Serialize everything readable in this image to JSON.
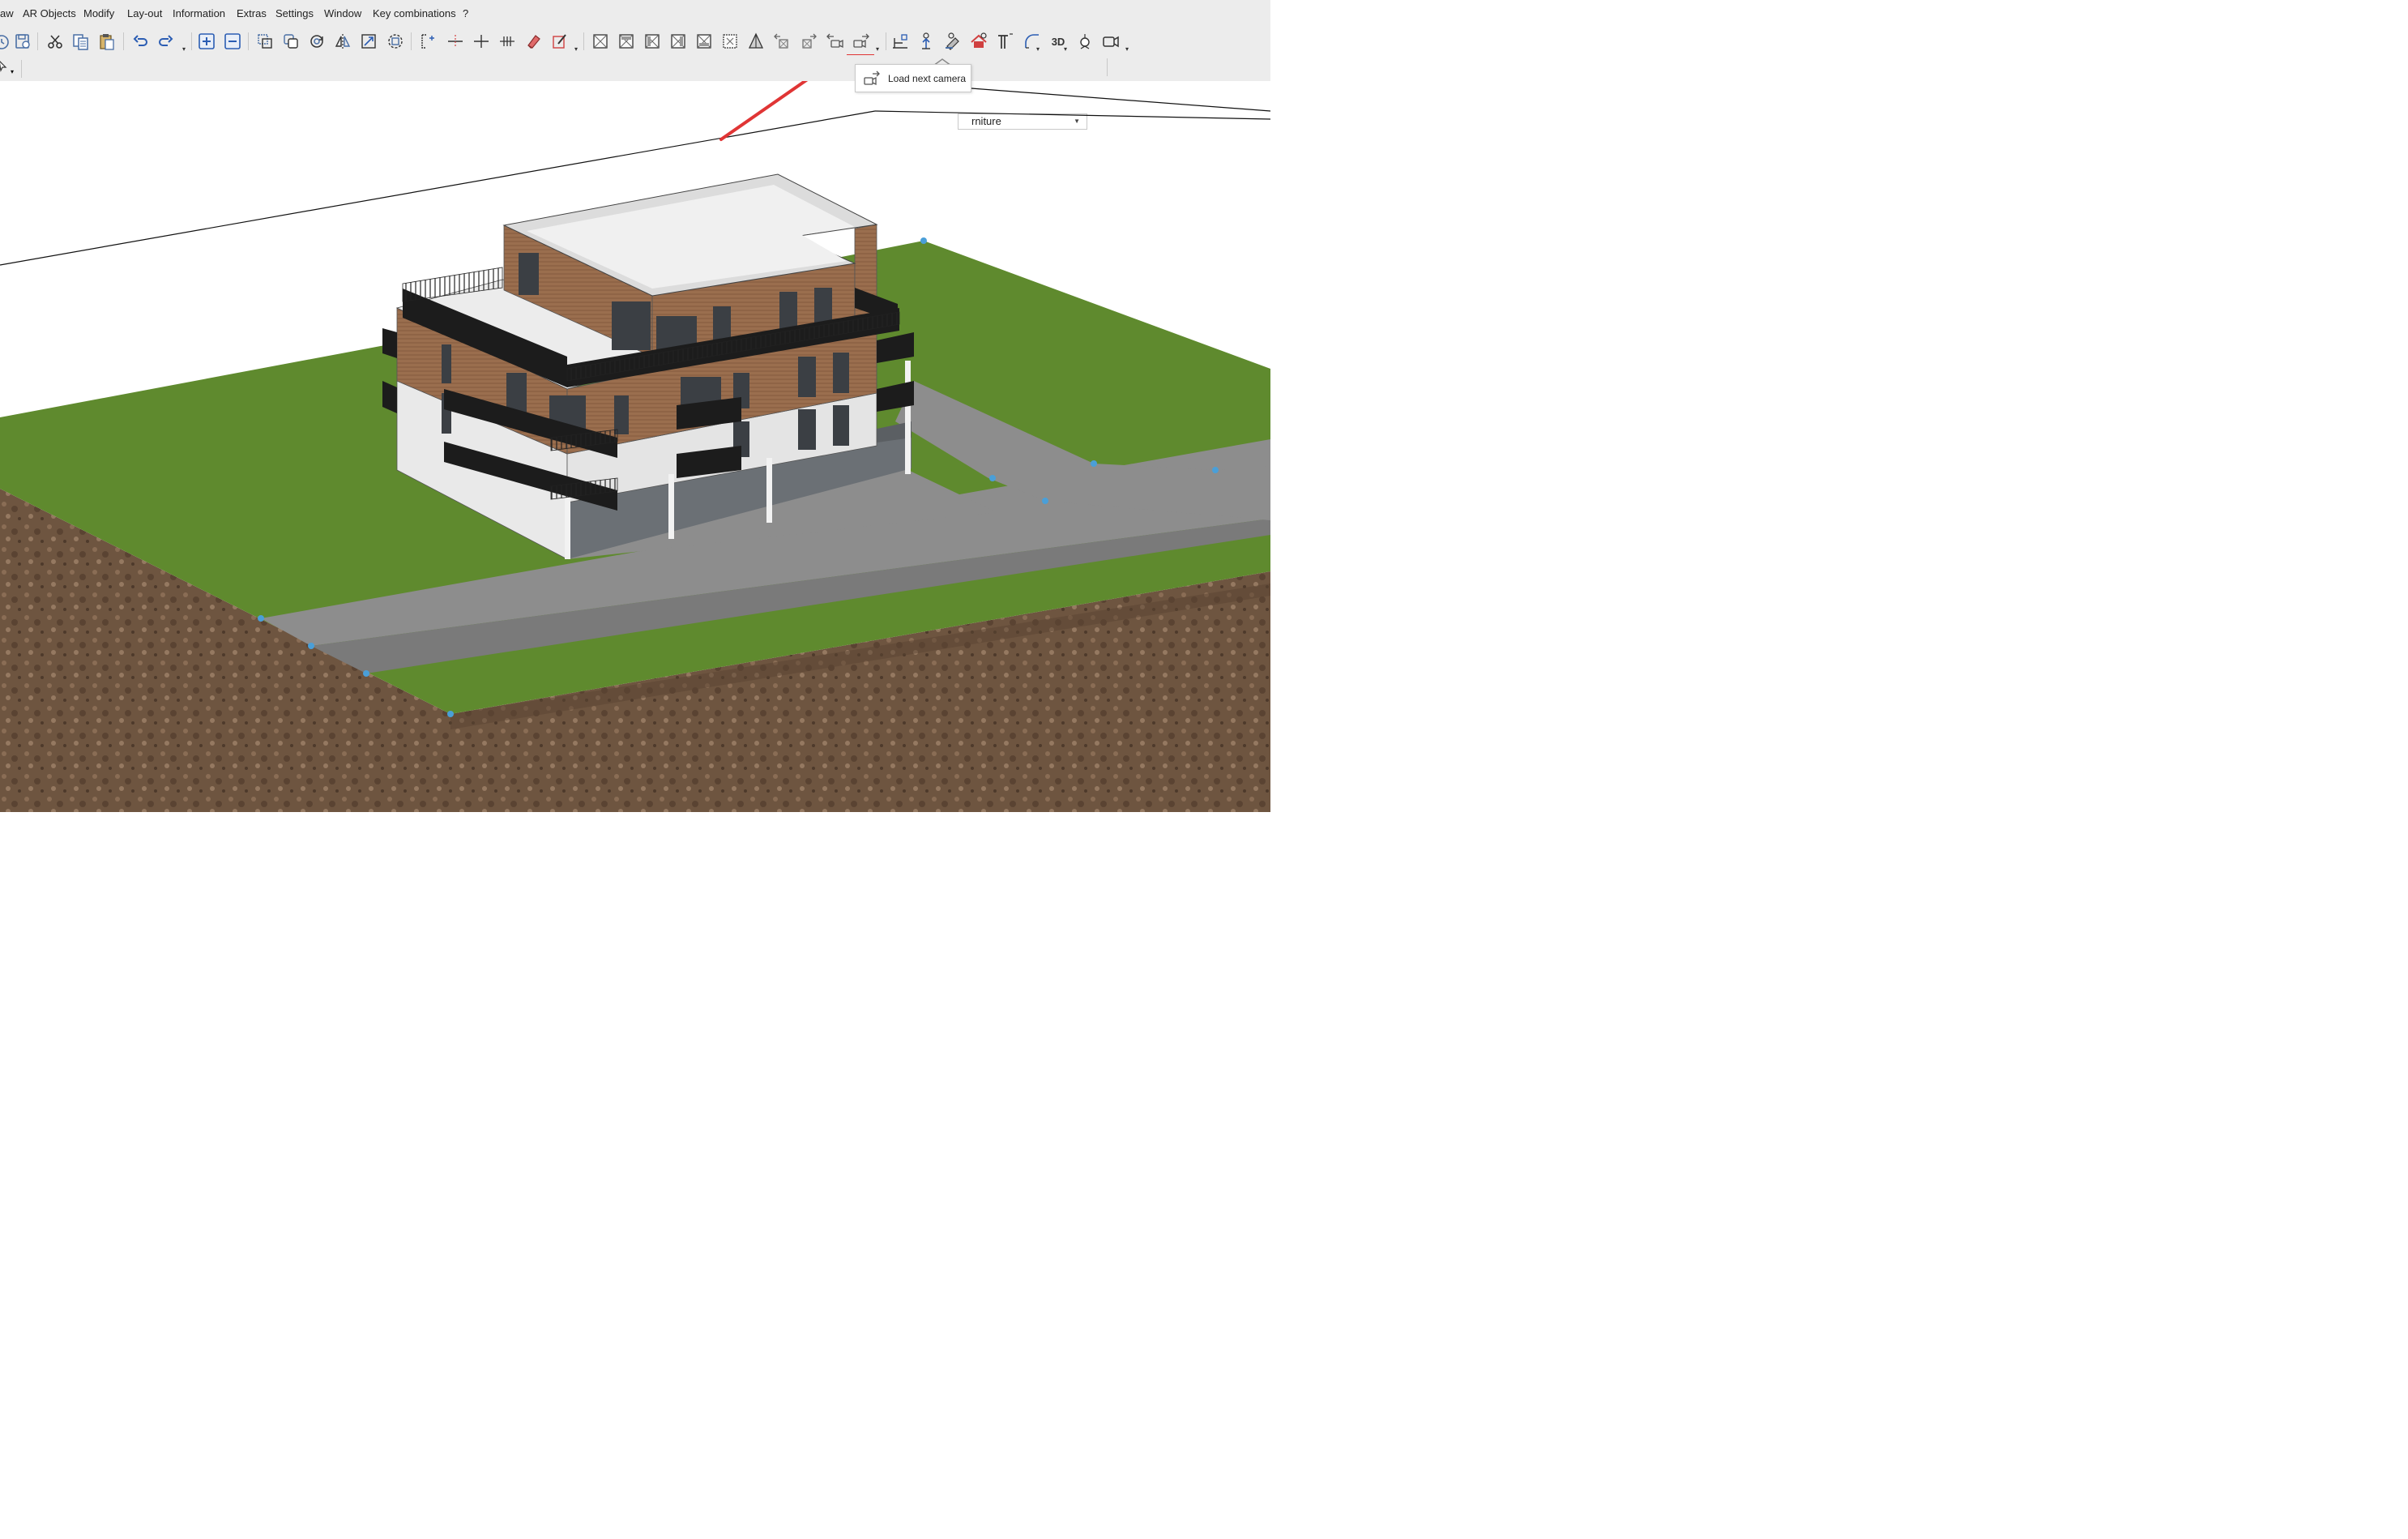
{
  "menubar": {
    "items": [
      "aw",
      "AR Objects",
      "Modify",
      "Lay-out",
      "Information",
      "Extras",
      "Settings",
      "Window",
      "Key combinations",
      "?"
    ]
  },
  "toolbar": {
    "icons": [
      "history-icon",
      "save-icon",
      "cut-icon",
      "copy-icon",
      "paste-icon",
      "undo-icon",
      "redo-icon",
      "add-icon",
      "subtract-icon",
      "copy-element-icon",
      "duplicate-icon",
      "rotate-icon",
      "mirror-icon",
      "stretch-icon",
      "offset-icon",
      "split-icon",
      "trim-icon",
      "extend-icon",
      "divide-icon",
      "eraser-icon",
      "edit-pen-icon",
      "view-front-icon",
      "view-back-icon",
      "view-left-icon",
      "view-right-icon",
      "view-top-icon",
      "view-bottom-icon",
      "perspective-icon",
      "previous-view-icon",
      "next-view-icon",
      "previous-camera-icon",
      "next-camera-icon",
      "level-icon",
      "elevation-icon",
      "paint-icon",
      "house-icon",
      "column-icon",
      "arc-icon",
      "3d-icon",
      "light-icon",
      "camera-icon"
    ],
    "threed_label": "3D"
  },
  "layer_select": {
    "value": "rniture"
  },
  "tooltip": {
    "text": "Load next camera"
  },
  "colors": {
    "highlight": "#e03535",
    "grass": "#5f8a2e",
    "soil": "#6e5540",
    "road": "#8d8d8d",
    "wood": "#9a6e4e",
    "render": "#e9e9e9"
  }
}
